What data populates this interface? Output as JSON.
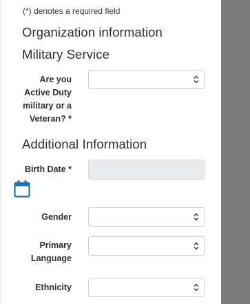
{
  "form": {
    "required_note": "(*) denotes a required field",
    "sections": {
      "organization": "Organization information",
      "military": "Military Service",
      "additional": "Additional Information"
    },
    "fields": {
      "military_status": {
        "label_lines": [
          "Are you",
          "Active Duty",
          "military or a",
          "Veteran? *"
        ],
        "value": ""
      },
      "birth_date": {
        "label": "Birth Date *",
        "value": ""
      },
      "gender": {
        "label": "Gender",
        "value": ""
      },
      "primary_language": {
        "label_lines": [
          "Primary",
          "Language"
        ],
        "value": ""
      },
      "ethnicity": {
        "label": "Ethnicity",
        "value": ""
      }
    },
    "icons": {
      "select_chevron": "chevron-updown-icon",
      "calendar": "calendar-icon"
    },
    "colors": {
      "accent": "#1f6fb2",
      "backdrop": "#7b7b7b",
      "disabled_field": "#e9ebee"
    }
  }
}
